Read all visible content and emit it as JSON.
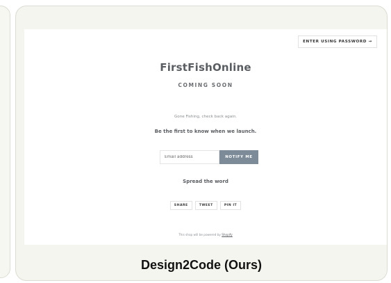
{
  "preview": {
    "password_button_label": "ENTER USING PASSWORD →",
    "shop_name": "FirstFishOnline",
    "coming_soon": "COMING SOON",
    "message": "Gone Fishing, check back again.",
    "first_to_know": "Be the first to know when we launch.",
    "email_placeholder": "Email address",
    "notify_label": "NOTIFY ME",
    "spread_heading": "Spread the word",
    "share_buttons": [
      "SHARE",
      "TWEET",
      "PIN IT"
    ],
    "powered_text": "This shop will be powered by",
    "powered_link": "Shopify"
  },
  "caption": "Design2Code (Ours)",
  "colors": {
    "card_background": "#f5f5ef",
    "card_border": "#dcdcd4",
    "notify_button": "#7d8b98",
    "heading_text": "#5a5d61"
  }
}
